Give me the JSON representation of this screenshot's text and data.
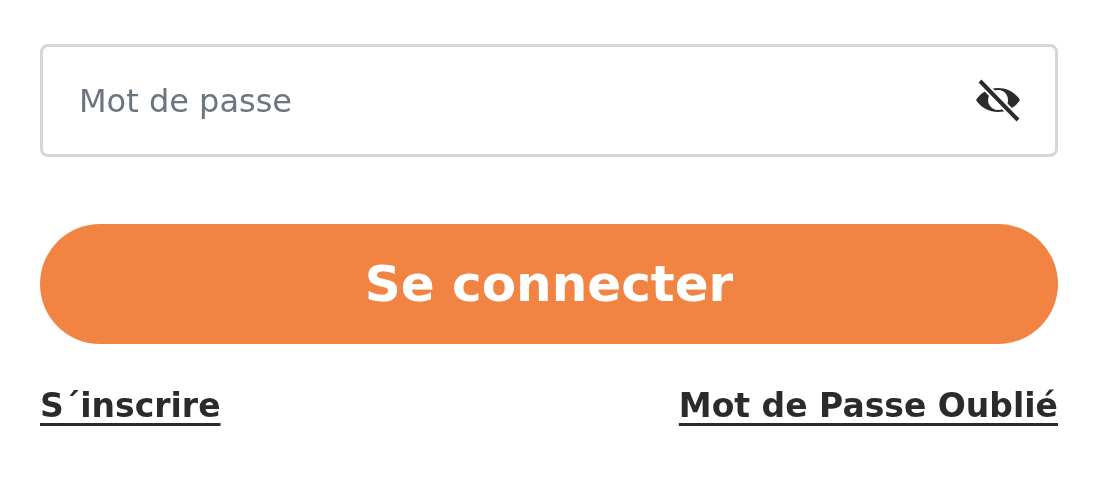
{
  "password_field": {
    "placeholder": "Mot de passe",
    "visible": false
  },
  "login_button": {
    "label": "Se connecter"
  },
  "links": [
    {
      "label": "S´inscrire"
    },
    {
      "label": "Mot de Passe Oublié"
    }
  ]
}
